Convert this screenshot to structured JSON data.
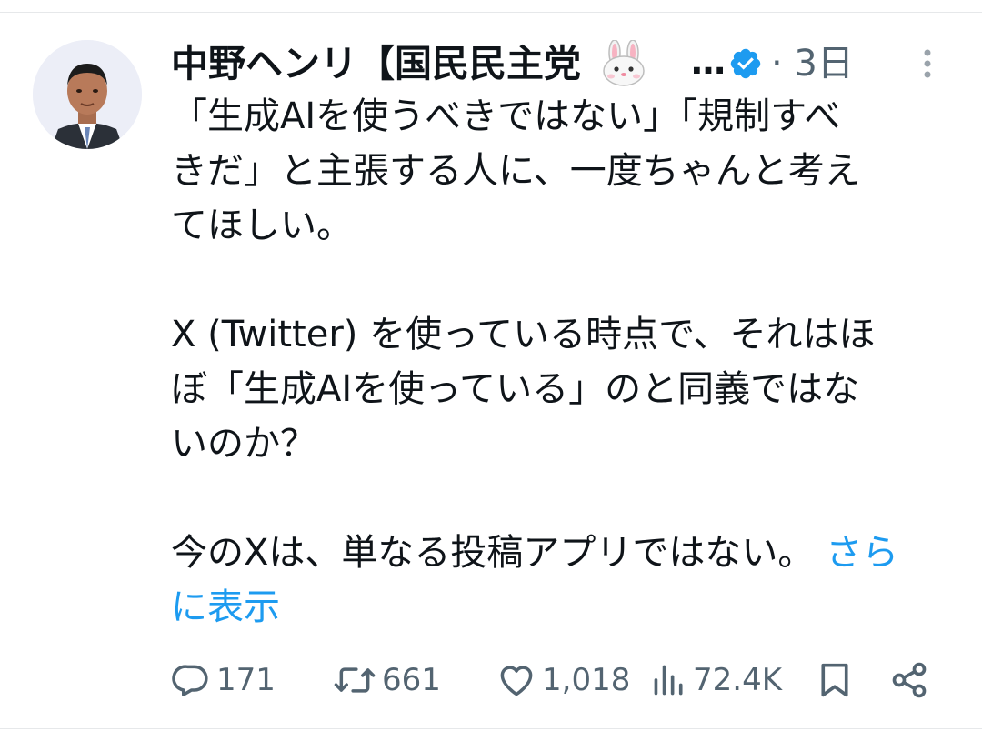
{
  "tweet": {
    "author_name": "中野ヘンリ【国民民主党",
    "ellipsis": "…",
    "time": "· 3日",
    "body_lines": [
      "「生成AIを使うべきではない」「規制すべ",
      "きだ」と主張する人に、一度ちゃんと考え",
      "てほしい。",
      "",
      "X (Twitter) を使っている時点で、それはほ",
      "ぼ「生成AIを使っている」のと同義ではな",
      "いのか？",
      "",
      "今のXは、単なる投稿アプリではない。"
    ],
    "show_more": "さら",
    "show_more_cont": "に表示"
  },
  "actions": {
    "replies": "171",
    "retweets": "661",
    "likes": "1,018",
    "views": "72.4K"
  },
  "icons": {
    "author_badge": "rabbit-emoji",
    "verified": "verified-badge-icon",
    "more": "more-vertical-icon",
    "reply": "reply-icon",
    "retweet": "retweet-icon",
    "like": "heart-icon",
    "views": "views-icon",
    "bookmark": "bookmark-icon",
    "share": "share-icon"
  },
  "colors": {
    "text": "#0f1419",
    "secondary": "#536471",
    "accent": "#1d9bf0",
    "divider": "#e6e8ea"
  }
}
